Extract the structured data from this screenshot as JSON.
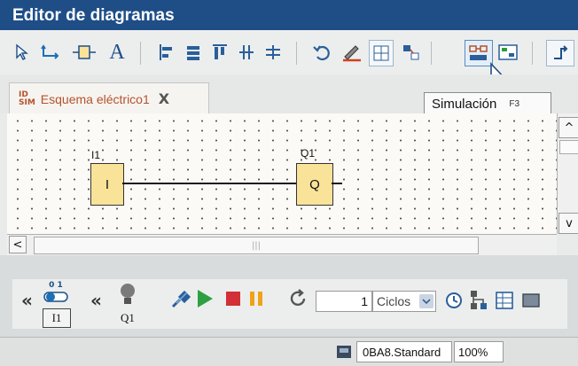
{
  "window": {
    "title": "Editor de diagramas"
  },
  "toolbar": {
    "items": [
      "pointer-icon",
      "connect-icon",
      "block-icon",
      "text-icon",
      "align-left-icon",
      "align-center-icon",
      "align-top-icon",
      "split-icon",
      "join-icon",
      "undo-icon",
      "pen-icon",
      "grid-icon",
      "block-numbers-icon",
      "simulation-icon",
      "online-test-icon",
      "more-icon"
    ],
    "text_tool_label": "A"
  },
  "tab": {
    "icon_text_top": "ID",
    "icon_text_bottom": "SIM",
    "label": "Esquema eléctrico1",
    "close": "X"
  },
  "tooltip": {
    "label": "Simulación",
    "shortcut": "F3"
  },
  "diagram": {
    "input_block": {
      "name": "I1",
      "text": "I"
    },
    "output_block": {
      "name": "Q1",
      "text": "Q"
    }
  },
  "scroll": {
    "thumb_grip": "|||",
    "left": "<",
    "up": "^",
    "down": "v"
  },
  "simulation": {
    "input_label": "I1",
    "output_label": "Q1",
    "switch_text": "0 1",
    "collapse": "«",
    "cycles_value": "1",
    "cycles_unit": "Ciclos",
    "play_color": "#2ea043",
    "stop_color": "#d22f36",
    "pause_color": "#f0a31a"
  },
  "status": {
    "hardware": "0BA8.Standard",
    "zoom": "100%"
  },
  "colors": {
    "titlebar": "#1f4e87",
    "block_fill": "#f9e399",
    "tab_text": "#b4522b"
  }
}
